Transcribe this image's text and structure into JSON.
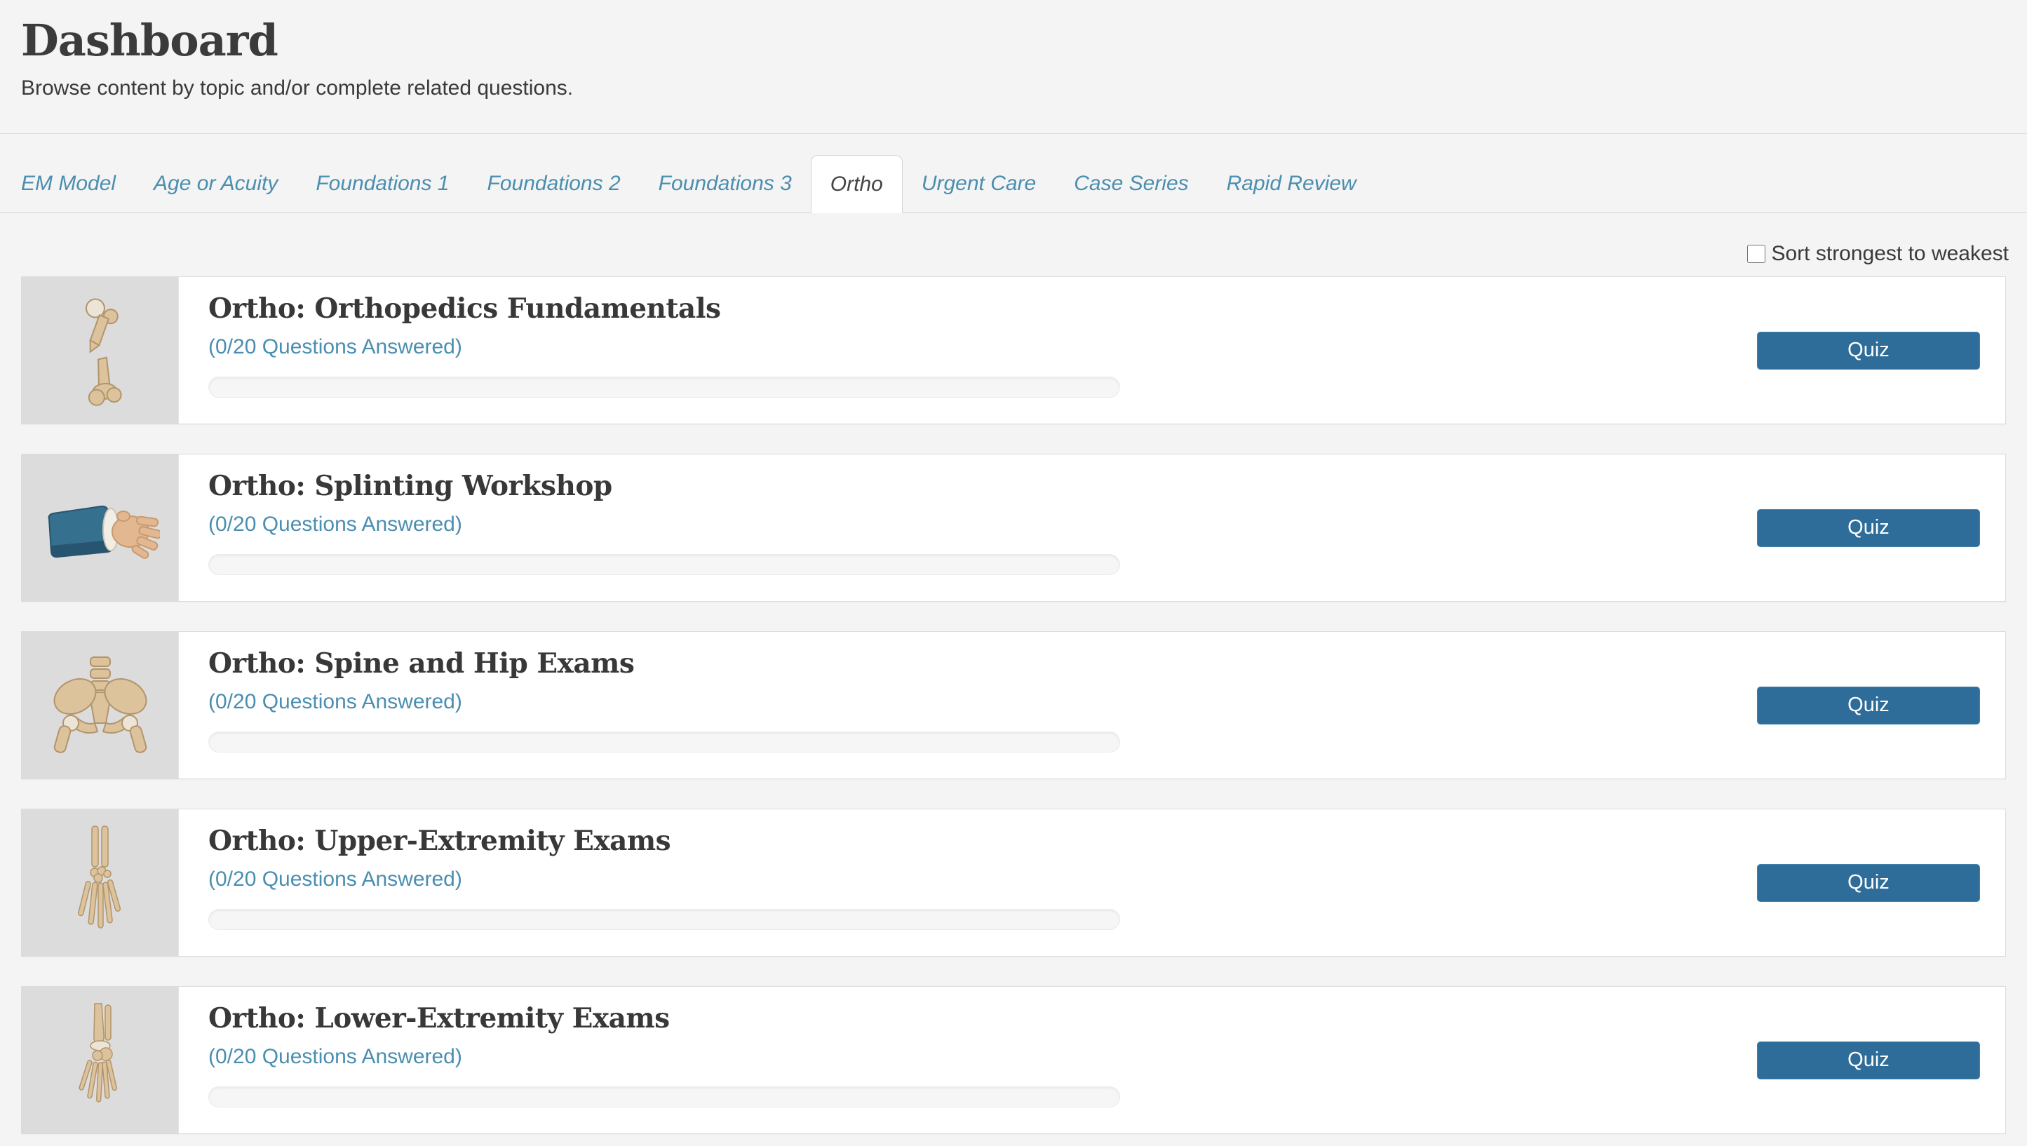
{
  "page": {
    "title": "Dashboard",
    "subtitle": "Browse content by topic and/or complete related questions."
  },
  "tabs": [
    {
      "label": "EM Model",
      "active": false
    },
    {
      "label": "Age or Acuity",
      "active": false
    },
    {
      "label": "Foundations 1",
      "active": false
    },
    {
      "label": "Foundations 2",
      "active": false
    },
    {
      "label": "Foundations 3",
      "active": false
    },
    {
      "label": "Ortho",
      "active": true
    },
    {
      "label": "Urgent Care",
      "active": false
    },
    {
      "label": "Case Series",
      "active": false
    },
    {
      "label": "Rapid Review",
      "active": false
    }
  ],
  "sort": {
    "label": "Sort strongest to weakest",
    "checked": false
  },
  "labels": {
    "quiz": "Quiz"
  },
  "courses": [
    {
      "title": "Ortho: Orthopedics Fundamentals",
      "progress_label": "(0/20 Questions Answered)",
      "answered": 0,
      "total": 20,
      "progress_percent": 0,
      "icon": "fractured-femur-icon"
    },
    {
      "title": "Ortho: Splinting Workshop",
      "progress_label": "(0/20 Questions Answered)",
      "answered": 0,
      "total": 20,
      "progress_percent": 0,
      "icon": "splinted-hand-icon"
    },
    {
      "title": "Ortho: Spine and Hip Exams",
      "progress_label": "(0/20 Questions Answered)",
      "answered": 0,
      "total": 20,
      "progress_percent": 0,
      "icon": "pelvis-icon"
    },
    {
      "title": "Ortho: Upper-Extremity Exams",
      "progress_label": "(0/20 Questions Answered)",
      "answered": 0,
      "total": 20,
      "progress_percent": 0,
      "icon": "hand-skeleton-icon"
    },
    {
      "title": "Ortho: Lower-Extremity Exams",
      "progress_label": "(0/20 Questions Answered)",
      "answered": 0,
      "total": 20,
      "progress_percent": 0,
      "icon": "foot-skeleton-icon"
    }
  ],
  "colors": {
    "page_background": "#f4f4f4",
    "accent_blue": "#4a8eb0",
    "button_blue": "#2e6d99",
    "card_background": "#ffffff",
    "thumbnail_background": "#dcdcdc",
    "title_text": "#383838"
  }
}
